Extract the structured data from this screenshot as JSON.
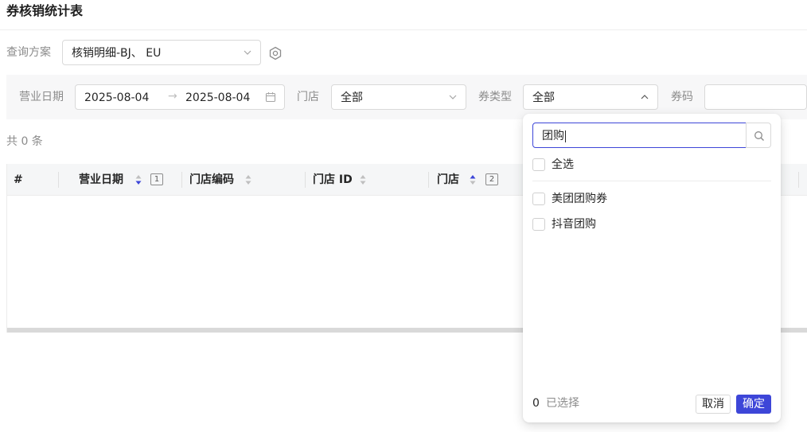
{
  "page": {
    "title": "券核销统计表"
  },
  "scheme": {
    "label": "查询方案",
    "value": "核销明细-BJ、 EU",
    "icons": {
      "dropdown": "chevron-down-icon",
      "settings": "gear-icon"
    }
  },
  "filters": {
    "date": {
      "label": "营业日期",
      "start": "2025-08-04",
      "separator": "→",
      "end": "2025-08-04",
      "icon": "calendar-icon"
    },
    "store": {
      "label": "门店",
      "value": "全部"
    },
    "coupon_type": {
      "label": "券类型",
      "value": "全部",
      "expanded": true
    },
    "coupon_code": {
      "label": "券码",
      "value": ""
    }
  },
  "summary": {
    "count_text": "共 0 条"
  },
  "table": {
    "columns": [
      {
        "label": "#"
      },
      {
        "label": "营业日期",
        "sort": "desc",
        "sort_order": "1"
      },
      {
        "label": "门店编码",
        "sort": "none"
      },
      {
        "label": "门店 ID",
        "sort": "none"
      },
      {
        "label": "门店",
        "sort": "asc",
        "sort_order": "2"
      }
    ],
    "rows": []
  },
  "dropdown": {
    "search_value": "团购",
    "select_all_label": "全选",
    "options": [
      {
        "label": "美团团购券",
        "checked": false
      },
      {
        "label": "抖音团购",
        "checked": false
      }
    ],
    "selected_count": "0",
    "selected_text": "已选择",
    "cancel_label": "取消",
    "confirm_label": "确定"
  },
  "colors": {
    "accent": "#3d46d8",
    "sort_active": "#3d46d8",
    "sort_inactive": "#bfbfbf",
    "filter_bg": "#f7f7f8",
    "header_bg": "#f5f6f7"
  }
}
